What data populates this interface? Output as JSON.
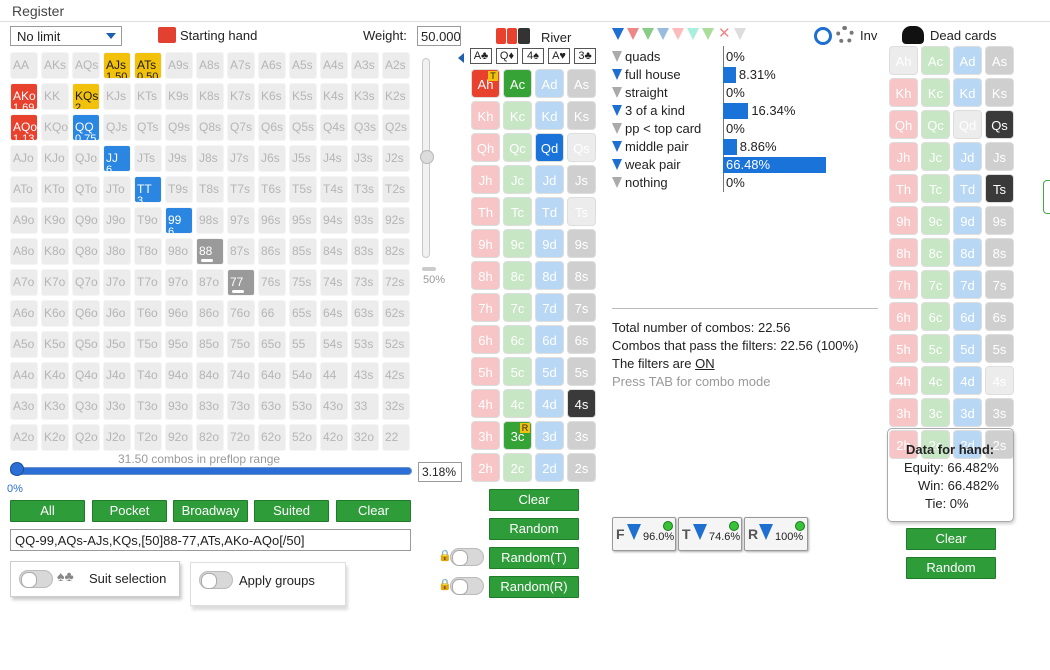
{
  "app": {
    "menu": "Register"
  },
  "left": {
    "limit": "No limit",
    "starting_hand": "Starting hand",
    "weight_label": "Weight:",
    "weight_value": "50.000",
    "slider_pct": "50%",
    "combos_label": "31.50 combos in preflop range",
    "range_pct": "3.18%",
    "range_slider_value": "0%",
    "buttons": [
      "All",
      "Pocket",
      "Broadway",
      "Suited",
      "Clear"
    ],
    "range_text": "QQ-99,AQs-AJs,KQs,[50]88-77,ATs,AKo-AQo[/50]",
    "suit_selection": "Suit selection",
    "apply_groups": "Apply groups",
    "grid_ranks": [
      "A",
      "K",
      "Q",
      "J",
      "T",
      "9",
      "8",
      "7",
      "6",
      "5",
      "4",
      "3",
      "2"
    ],
    "grid_active": {
      "AJs": [
        "yel",
        "1.50"
      ],
      "ATs": [
        "yel",
        "0.50"
      ],
      "KQs": [
        "yel",
        "2"
      ],
      "AKo": [
        "red",
        "1.69"
      ],
      "AQo": [
        "red",
        "1.13"
      ],
      "QQ": [
        "blu",
        "0.75"
      ],
      "JJ": [
        "blu",
        "6"
      ],
      "TT": [
        "blu",
        "3"
      ],
      "99": [
        "blu",
        "6"
      ],
      "88": [
        "gry",
        ""
      ],
      "77": [
        "gry",
        ""
      ]
    }
  },
  "river": {
    "label": "River",
    "board": [
      "A♣",
      "Q♦",
      "4♠",
      "A♥",
      "3♣"
    ],
    "ranks": [
      "A",
      "K",
      "Q",
      "J",
      "T",
      "9",
      "8",
      "7",
      "6",
      "5",
      "4",
      "3",
      "2"
    ],
    "active": [
      "Ah",
      "Ac",
      "Qd",
      "4s",
      "3c"
    ],
    "dim": [
      "Qs",
      "Ts"
    ],
    "badges": {
      "Ah": "T",
      "3c": "R"
    },
    "buttons": [
      "Clear",
      "Random",
      "Random(T)",
      "Random(R)"
    ]
  },
  "filters": {
    "inv": "Inv",
    "rows": [
      {
        "name": "quads",
        "pct": "0%",
        "val": 0,
        "on": false
      },
      {
        "name": "full house",
        "pct": "8.31%",
        "val": 8.31,
        "on": true
      },
      {
        "name": "straight",
        "pct": "0%",
        "val": 0,
        "on": false
      },
      {
        "name": "3 of a kind",
        "pct": "16.34%",
        "val": 16.34,
        "on": true
      },
      {
        "name": "pp < top card",
        "pct": "0%",
        "val": 0,
        "on": false
      },
      {
        "name": "middle pair",
        "pct": "8.86%",
        "val": 8.86,
        "on": true
      },
      {
        "name": "weak pair",
        "pct": "66.48%",
        "val": 66.48,
        "on": true
      },
      {
        "name": "nothing",
        "pct": "0%",
        "val": 0,
        "on": false
      }
    ],
    "total": "Total number of combos: 22.56",
    "pass": "Combos that pass the filters: 22.56 (100%)",
    "filters_are": "The filters are ",
    "filters_state": "ON",
    "tab_hint": "Press TAB for combo mode",
    "summary": [
      {
        "letter": "F",
        "value": "96.0%"
      },
      {
        "letter": "T",
        "value": "74.6%"
      },
      {
        "letter": "R",
        "value": "100%"
      }
    ],
    "colors": {
      "active": "#1e6fd0",
      "inactive": "#aaaaaa"
    }
  },
  "dead": {
    "label": "Dead cards",
    "active": [
      "Qs",
      "Ts"
    ],
    "dim": [
      "Ah",
      "Ac",
      "Qd",
      "4s",
      "3c"
    ],
    "hand_title": "Data for hand:",
    "equity": "Equity: 66.482%",
    "win": "Win: 66.482%",
    "tie": "Tie: 0%",
    "buttons": [
      "Clear",
      "Random"
    ]
  }
}
